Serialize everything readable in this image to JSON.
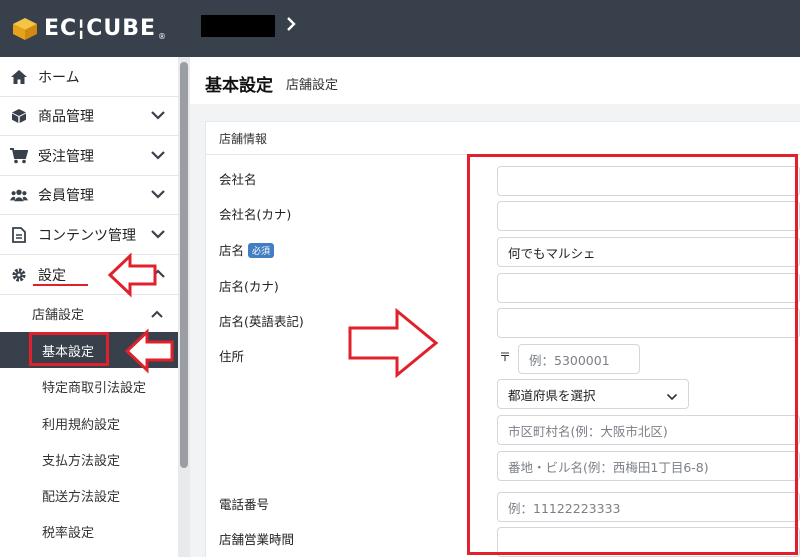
{
  "header": {
    "logo_text": "EC¦CUBE",
    "logo_tm": "®",
    "chevron": "›"
  },
  "sidebar": {
    "items": [
      {
        "label": "ホーム",
        "icon": "home-icon"
      },
      {
        "label": "商品管理",
        "icon": "box-icon"
      },
      {
        "label": "受注管理",
        "icon": "cart-icon"
      },
      {
        "label": "会員管理",
        "icon": "users-icon"
      },
      {
        "label": "コンテンツ管理",
        "icon": "file-icon"
      },
      {
        "label": "設定",
        "icon": "gear-icon"
      }
    ],
    "sub_group": "店舗設定",
    "sub_items": [
      "基本設定",
      "特定商取引法設定",
      "利用規約設定",
      "支払方法設定",
      "配送方法設定",
      "税率設定"
    ]
  },
  "page": {
    "title": "基本設定",
    "subtitle": "店舗設定"
  },
  "card": {
    "title": "店舗情報",
    "required_badge": "必須",
    "labels": {
      "company_name": "会社名",
      "company_kana": "会社名(カナ)",
      "shop_name": "店名",
      "shop_kana": "店名(カナ)",
      "shop_en": "店名(英語表記)",
      "address": "住所",
      "phone": "電話番号",
      "hours": "店舗営業時間"
    },
    "values": {
      "shop_name": "何でもマルシェ"
    },
    "placeholders": {
      "postal_mark": "〒",
      "postal": "例：5300001",
      "prefecture": "都道府県を選択",
      "city": "市区町村名(例：大阪市北区)",
      "street": "番地・ビル名(例：西梅田1丁目6-8)",
      "phone": "例：11122223333"
    }
  },
  "colors": {
    "header_bg": "#38404b",
    "accent_red": "#e0202b",
    "badge_blue": "#437ec4",
    "logo_gold": "#f0b12a"
  }
}
